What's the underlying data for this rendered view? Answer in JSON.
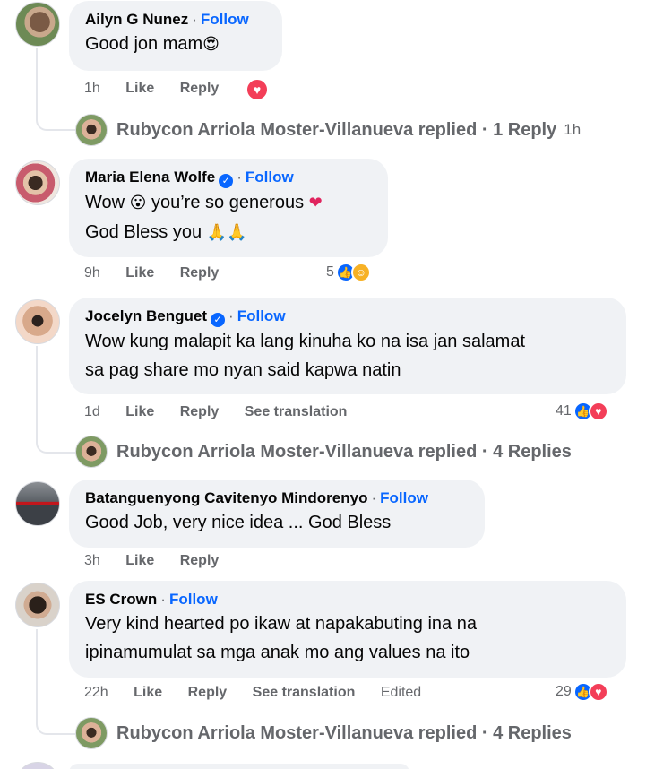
{
  "comments": [
    {
      "name": "Ailyn G Nunez",
      "follow": "Follow",
      "text": "Good jon mam",
      "emoji": "😍",
      "time": "1h",
      "like": "Like",
      "reply": "Reply",
      "reaction_icon": "love-icon"
    },
    {
      "name": "Maria Elena Wolfe",
      "follow": "Follow",
      "line1": "Wow",
      "line1_emoji1": "😮",
      "line1_rest": "you’re so generous",
      "line1_emoji2": "❤",
      "line2": "God Bless you",
      "line2_emoji": "🙏🙏",
      "time": "9h",
      "like": "Like",
      "reply": "Reply",
      "reaction_count": "5"
    },
    {
      "name": "Jocelyn Benguet",
      "follow": "Follow",
      "line1": "Wow kung malapit ka lang kinuha ko na isa jan salamat",
      "line2": "sa pag share mo nyan said kapwa natin",
      "time": "1d",
      "like": "Like",
      "reply": "Reply",
      "translate": "See translation",
      "reaction_count": "41"
    },
    {
      "name": "Batanguenyong Cavitenyo Mindorenyo",
      "follow": "Follow",
      "text": "Good Job, very nice idea ... God Bless",
      "time": "3h",
      "like": "Like",
      "reply": "Reply"
    },
    {
      "name": "ES Crown",
      "follow": "Follow",
      "line1": "Very kind hearted po ikaw at napakabuting ina na",
      "line2": "ipinamumulat sa mga anak mo ang values na ito",
      "time": "22h",
      "like": "Like",
      "reply": "Reply",
      "translate": "See translation",
      "edited": "Edited",
      "reaction_count": "29"
    }
  ],
  "replies": [
    {
      "text": "Rubycon Arriola Moster-Villanueva replied · 1 Reply",
      "time": "1h"
    },
    {
      "text": "Rubycon Arriola Moster-Villanueva replied · 4 Replies"
    },
    {
      "text": "Rubycon Arriola Moster-Villanueva replied · 4 Replies"
    }
  ]
}
